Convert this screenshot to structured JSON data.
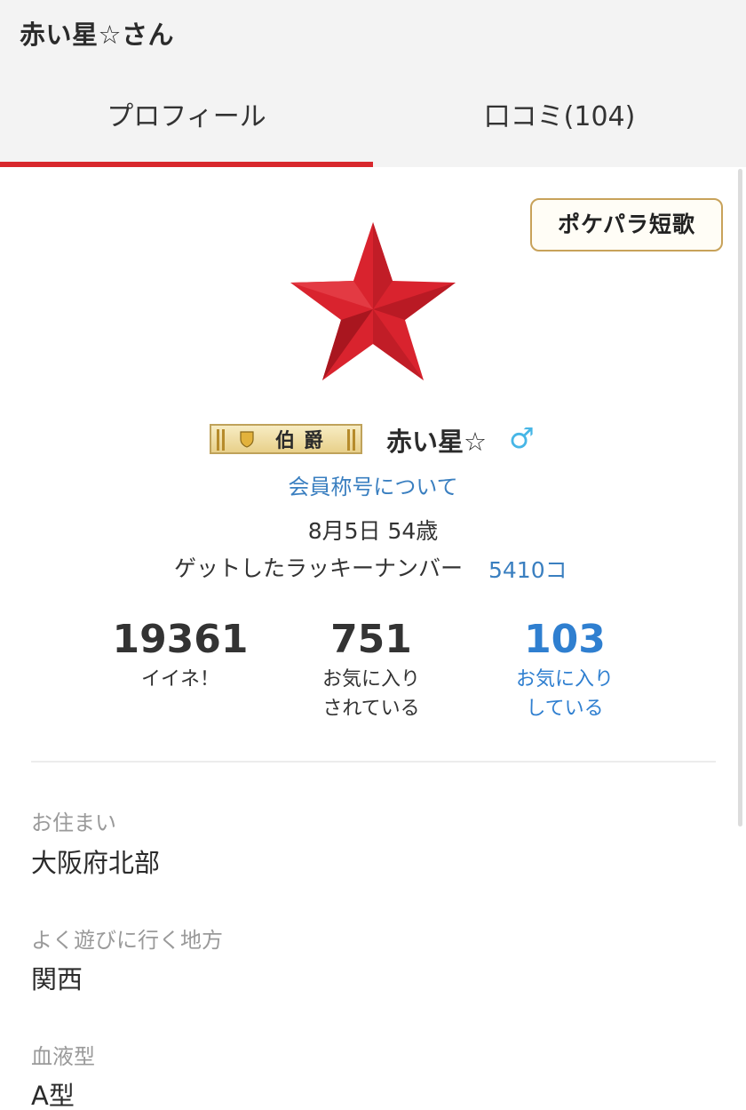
{
  "header": {
    "title": "赤い星☆さん",
    "tabs": [
      {
        "label": "プロフィール",
        "active": true
      },
      {
        "label": "口コミ(104)",
        "active": false
      }
    ]
  },
  "tanka_button": "ポケパラ短歌",
  "profile": {
    "rank": "伯爵",
    "username": "赤い星☆",
    "gender_symbol": "♂",
    "title_link": "会員称号について",
    "birth": "8月5日 54歳",
    "lucky_label": "ゲットしたラッキーナンバー",
    "lucky_value": "5410コ"
  },
  "stats": [
    {
      "value": "19361",
      "label_line1": "イイネ！",
      "label_line2": ""
    },
    {
      "value": "751",
      "label_line1": "お気に入り",
      "label_line2": "されている"
    },
    {
      "value": "103",
      "label_line1": "お気に入り",
      "label_line2": "している"
    }
  ],
  "fields": [
    {
      "label": "お住まい",
      "value": "大阪府北部"
    },
    {
      "label": "よく遊びに行く地方",
      "value": "関西"
    },
    {
      "label": "血液型",
      "value": "A型"
    }
  ],
  "colors": {
    "accent_red": "#d8282d",
    "link_blue": "#3a7fc0",
    "gender_blue": "#47b6e6"
  }
}
